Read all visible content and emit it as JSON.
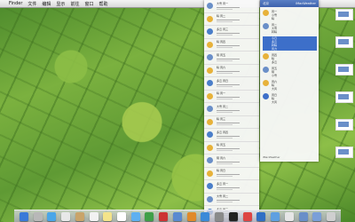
{
  "menubar": {
    "apple": "",
    "items": [
      "Finder",
      "文件",
      "编辑",
      "显示",
      "前往",
      "窗口",
      "帮助"
    ],
    "right": [
      "",
      "",
      ""
    ]
  },
  "weather_panel": {
    "header_left": "北京",
    "header_right": "iMacWeather",
    "days": [
      {
        "color": "#e7b23a",
        "lines": [
          "周一",
          "小雪",
          "晴"
        ]
      },
      {
        "color": "#6a8fc8",
        "lines": [
          "周二",
          "大雪",
          "转晴"
        ]
      },
      {
        "color": "#3d6fc9",
        "lines": [
          "今日",
          "多云",
          "转晴",
          "风力"
        ],
        "selected": true
      },
      {
        "color": "#e7b23a",
        "lines": [
          "周四",
          "晴",
          "多云"
        ]
      },
      {
        "color": "#6a8fc8",
        "lines": [
          "周五",
          "阴",
          "小雪"
        ]
      },
      {
        "color": "#e7b23a",
        "lines": [
          "周六",
          "晴",
          "大风"
        ]
      },
      {
        "color": "#3d6fc9",
        "lines": [
          "周日",
          "晴",
          "大风"
        ]
      }
    ],
    "footer": "iMacWeather"
  },
  "list_panel": {
    "items": [
      {
        "color": "#6a8fc8",
        "text": "大雪 周一"
      },
      {
        "color": "#e7b23a",
        "text": "晴 周二"
      },
      {
        "color": "#4a7ec9",
        "text": "多云 周三"
      },
      {
        "color": "#e7b23a",
        "text": "晴 周四"
      },
      {
        "color": "#6a8fc8",
        "text": "阴 周五"
      },
      {
        "color": "#e7b23a",
        "text": "晴 周六"
      },
      {
        "color": "#4a7ec9",
        "text": "多云 周日"
      },
      {
        "color": "#e7b23a",
        "text": "晴 周一"
      },
      {
        "color": "#6a8fc8",
        "text": "大雪 周二"
      },
      {
        "color": "#e7b23a",
        "text": "晴 周三"
      },
      {
        "color": "#4a7ec9",
        "text": "多云 周四"
      },
      {
        "color": "#e7b23a",
        "text": "晴 周五"
      },
      {
        "color": "#6a8fc8",
        "text": "阴 周六"
      },
      {
        "color": "#e7b23a",
        "text": "晴 周日"
      },
      {
        "color": "#4a7ec9",
        "text": "多云 周一"
      },
      {
        "color": "#6a8fc8",
        "text": "大雪 周二"
      },
      {
        "color": "#4a7ec9",
        "text": "多云 周三"
      }
    ]
  },
  "dock": {
    "icons": [
      {
        "name": "finder-icon",
        "color": "#3b7ad8"
      },
      {
        "name": "launchpad-icon",
        "color": "#b8b8b8"
      },
      {
        "name": "safari-icon",
        "color": "#4aa6e8"
      },
      {
        "name": "mail-icon",
        "color": "#e8e8e8"
      },
      {
        "name": "contacts-icon",
        "color": "#c9a46a"
      },
      {
        "name": "calendar-icon",
        "color": "#f2f2f2"
      },
      {
        "name": "notes-icon",
        "color": "#f4e48a"
      },
      {
        "name": "reminders-icon",
        "color": "#ffffff"
      },
      {
        "name": "messages-icon",
        "color": "#5fb0f0"
      },
      {
        "name": "facetime-icon",
        "color": "#3fa048"
      },
      {
        "name": "photobooth-icon",
        "color": "#c33"
      },
      {
        "name": "itunes-icon",
        "color": "#5a8ad0"
      },
      {
        "name": "ibooks-icon",
        "color": "#e08a2a"
      },
      {
        "name": "appstore-icon",
        "color": "#3c8ad8"
      },
      {
        "name": "preferences-icon",
        "color": "#8a8a8a"
      },
      {
        "name": "qq-icon",
        "color": "#222"
      },
      {
        "name": "app-icon",
        "color": "#d44"
      },
      {
        "name": "weather-icon",
        "color": "#2f6fc4"
      },
      {
        "name": "network-icon",
        "color": "#5fa0e0"
      },
      {
        "name": "app2-icon",
        "color": "#e6e6e6"
      },
      {
        "name": "downloads-icon",
        "color": "#6a8fc8"
      },
      {
        "name": "documents-icon",
        "color": "#7a9fd8"
      },
      {
        "name": "trash-icon",
        "color": "#cfcfcf"
      }
    ]
  }
}
